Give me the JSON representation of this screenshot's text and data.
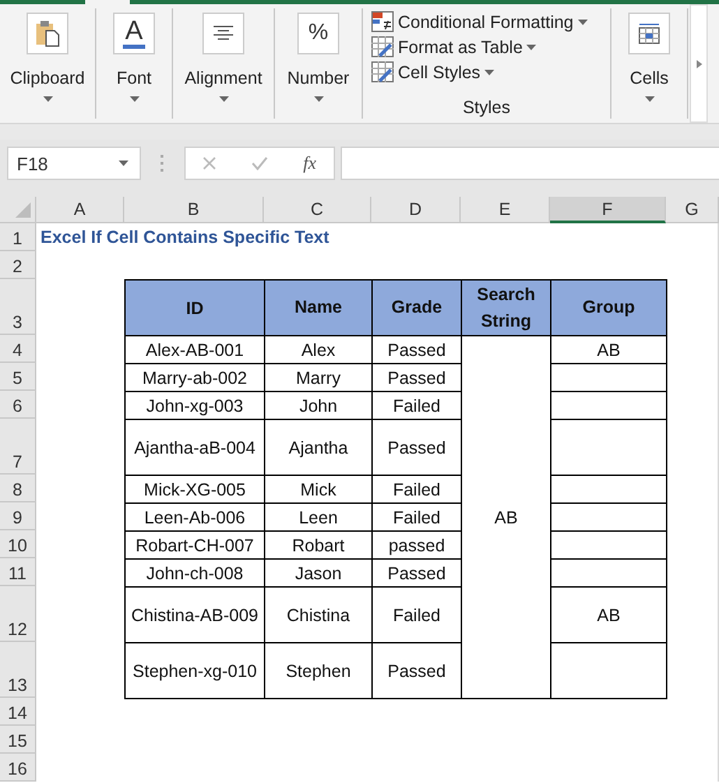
{
  "ribbon": {
    "groups": [
      {
        "kind": "big",
        "label": "Clipboard"
      },
      {
        "kind": "big",
        "label": "Font",
        "icon_text": "A"
      },
      {
        "kind": "big",
        "label": "Alignment"
      },
      {
        "kind": "big",
        "label": "Number",
        "icon_text": "%"
      },
      {
        "kind": "commands",
        "label": "Styles",
        "commands": [
          {
            "label": "Conditional Formatting"
          },
          {
            "label": "Format as Table"
          },
          {
            "label": "Cell Styles"
          }
        ]
      },
      {
        "kind": "big",
        "label": "Cells"
      }
    ]
  },
  "name_box": "F18",
  "formula_function": "fx",
  "columns": [
    {
      "label": "A",
      "selected": false
    },
    {
      "label": "B",
      "selected": false
    },
    {
      "label": "C",
      "selected": false
    },
    {
      "label": "D",
      "selected": false
    },
    {
      "label": "E",
      "selected": false
    },
    {
      "label": "F",
      "selected": true
    },
    {
      "label": "G",
      "selected": false
    }
  ],
  "rows": [
    {
      "number": "1",
      "tall": false
    },
    {
      "number": "2",
      "tall": false
    },
    {
      "number": "3",
      "tall": true
    },
    {
      "number": "4",
      "tall": false
    },
    {
      "number": "5",
      "tall": false
    },
    {
      "number": "6",
      "tall": false
    },
    {
      "number": "7",
      "tall": true
    },
    {
      "number": "8",
      "tall": false
    },
    {
      "number": "9",
      "tall": false
    },
    {
      "number": "10",
      "tall": false
    },
    {
      "number": "11",
      "tall": false
    },
    {
      "number": "12",
      "tall": true
    },
    {
      "number": "13",
      "tall": true
    },
    {
      "number": "14",
      "tall": false
    },
    {
      "number": "15",
      "tall": false
    },
    {
      "number": "16",
      "tall": false
    }
  ],
  "title": "Excel If Cell Contains Specific Text",
  "table": {
    "columns": [
      "ID",
      "Name",
      "Grade",
      "Search String",
      "Group"
    ],
    "search_string": "AB",
    "rows": [
      {
        "id": "Alex-AB-001",
        "name": "Alex",
        "grade": "Passed",
        "group": "AB"
      },
      {
        "id": "Marry-ab-002",
        "name": "Marry",
        "grade": "Passed"
      },
      {
        "id": "John-xg-003",
        "name": "John",
        "grade": "Failed"
      },
      {
        "id": "Ajantha-aB-004",
        "name": "Ajantha",
        "grade": "Passed"
      },
      {
        "id": "Mick-XG-005",
        "name": "Mick",
        "grade": "Failed"
      },
      {
        "id": "Leen-Ab-006",
        "name": "Leen",
        "grade": "Failed"
      },
      {
        "id": "Robart-CH-007",
        "name": "Robart",
        "grade": "passed"
      },
      {
        "id": "John-ch-008",
        "name": "Jason",
        "grade": "Passed"
      },
      {
        "id": "Chistina-AB-009",
        "name": "Chistina",
        "grade": "Failed",
        "group": "AB"
      },
      {
        "id": "Stephen-xg-010",
        "name": "Stephen",
        "grade": "Passed"
      }
    ]
  }
}
